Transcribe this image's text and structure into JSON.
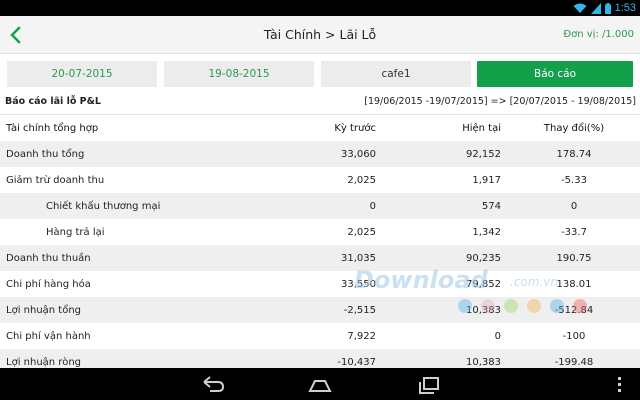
{
  "status": {
    "time": "1:53"
  },
  "appbar": {
    "title": "Tài Chính > Lãi Lỗ",
    "unit": "Đơn vị: /1.000"
  },
  "filters": {
    "from_date": "20-07-2015",
    "to_date": "19-08-2015",
    "company": "cafe1",
    "report_button": "Báo cáo"
  },
  "report": {
    "title": "Báo cáo lãi lỗ P&L",
    "range": "[19/06/2015 -19/07/2015] => [20/07/2015 - 19/08/2015]"
  },
  "table": {
    "headers": {
      "name": "Tài chính tổng hợp",
      "prev": "Kỳ trước",
      "cur": "Hiện tại",
      "chg": "Thay đổi(%)"
    },
    "rows": [
      {
        "name": "Doanh thu tổng",
        "prev": "33,060",
        "cur": "92,152",
        "chg": "178.74"
      },
      {
        "name": "Giảm trừ doanh thu",
        "prev": "2,025",
        "cur": "1,917",
        "chg": "-5.33"
      },
      {
        "name": "Chiết khấu thương mại",
        "prev": "0",
        "cur": "574",
        "chg": "0"
      },
      {
        "name": "Hàng trả lại",
        "prev": "2,025",
        "cur": "1,342",
        "chg": "-33.7"
      },
      {
        "name": "Doanh thu thuần",
        "prev": "31,035",
        "cur": "90,235",
        "chg": "190.75"
      },
      {
        "name": "Chi phí hàng hóa",
        "prev": "33,550",
        "cur": "79,852",
        "chg": "138.01"
      },
      {
        "name": "Lợi nhuận tổng",
        "prev": "-2,515",
        "cur": "10,383",
        "chg": "-512.84"
      },
      {
        "name": "Chi phí vận hành",
        "prev": "7,922",
        "cur": "0",
        "chg": "-100"
      },
      {
        "name": "Lợi nhuận ròng",
        "prev": "-10,437",
        "cur": "10,383",
        "chg": "-199.48"
      }
    ]
  },
  "watermark": "Download.com.vn",
  "colors": {
    "accent": "#12a04a",
    "accent_text": "#2b9a4f",
    "status_blue": "#33b5e5"
  }
}
